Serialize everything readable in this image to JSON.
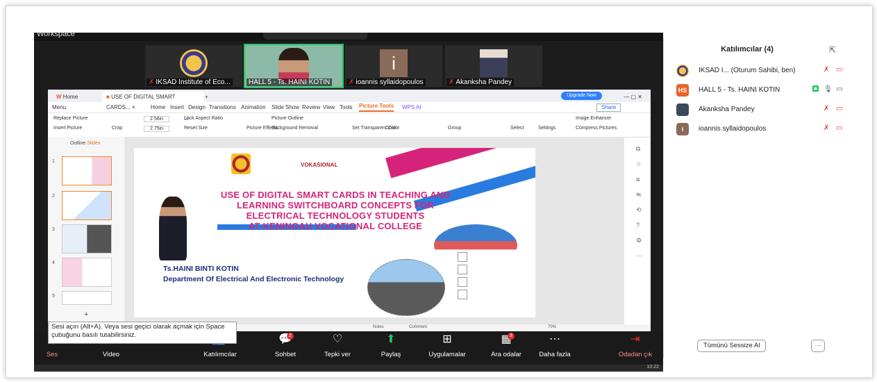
{
  "workspace_label": "Workspace",
  "thumbnails": [
    {
      "name": "IKSAD Institute of Eco...",
      "muted": true
    },
    {
      "name": "HALL 5 - Ts. HAINI KOTIN",
      "muted": false
    },
    {
      "name": "ioannis syllaidopoulos",
      "muted": true,
      "initial": "i"
    },
    {
      "name": "Akanksha Pandey",
      "muted": true
    }
  ],
  "wps": {
    "home_tab": "Home",
    "doc_tab": "USE OF DIGITAL SMART CARDS...",
    "upgrade": "Upgrade Now",
    "share": "Share",
    "menu": [
      "Menu",
      "Home",
      "Insert",
      "Design",
      "Transitions",
      "Animation",
      "Slide Show",
      "Review",
      "View",
      "Tools",
      "Picture Tools",
      "WPS AI"
    ],
    "ribbon": {
      "replace_picture": "Replace Picture",
      "insert_picture": "Insert Picture",
      "crop": "Crop",
      "width": "2.56in",
      "height": "2.75in",
      "lock_aspect": "Lock Aspect Ratio",
      "reset_size": "Reset Size",
      "picture_effects": "Picture Effects",
      "picture_outline": "Picture Outline",
      "background_removal": "Background Removal",
      "set_transparent": "Set Transparent Color",
      "color": "Color",
      "group": "Group",
      "select": "Select",
      "settings": "Settings",
      "image_enhancer": "Image Enhancer",
      "compress_pictures": "Compress Pictures"
    },
    "outline_tab": "Outline",
    "slides_tab": "Slides",
    "slide_numbers": [
      "1",
      "2",
      "3",
      "4",
      "5"
    ],
    "add_slide": "+",
    "slide": {
      "logo_text": "VOKASIONAL",
      "title_lines": [
        "USE OF DIGITAL SMART CARDS IN TEACHING AND",
        "LEARNING SWITCHBOARD CONCEPTS FOR",
        "ELECTRICAL TECHNOLOGY STUDENTS",
        "AT KENINGAU VOCATIONAL COLLEGE"
      ],
      "author": "Ts.HAINI BINTI KOTIN",
      "department": "Department Of Electrical And Electronic Technology"
    },
    "status": {
      "notes": "Notes",
      "comment": "Comment",
      "zoom": "70%"
    }
  },
  "tooltip": "Sesi açın (Alt+A). Veya sesi geçici olarak açmak için Space çubuğunu basılı tutabilirsiniz.",
  "toolbar": {
    "audio": "Ses",
    "video": "Video",
    "participants": "Katılımcılar",
    "participants_count": "4",
    "chat": "Sohbet",
    "chat_badge": "2",
    "react": "Tepki ver",
    "share": "Paylaş",
    "apps": "Uygulamalar",
    "apps_badge": "3",
    "breakout": "Ara odalar",
    "more": "Daha fazla",
    "leave": "Odadan çık"
  },
  "panel": {
    "title": "Katılımcılar (4)",
    "participants": [
      {
        "name": "IKSAD I... (Oturum Sahibi, ben)",
        "avatar": "",
        "color": "#ffffff"
      },
      {
        "name": "HALL 5 - Ts. HAINI KOTIN",
        "avatar": "HS",
        "color": "#e8622a"
      },
      {
        "name": "Akanksha Pandey",
        "avatar": "",
        "color": "#3a4a5c"
      },
      {
        "name": "ioannis syllaidopoulos",
        "avatar": "i",
        "color": "#8a6a58"
      }
    ],
    "mute_all": "Tümünü Sessize Al",
    "more": "···"
  },
  "clock": "10:22",
  "colors": {
    "accent_green": "#22c55e",
    "muted_red": "#e0322a",
    "slide_title": "#d6247a",
    "slide_author": "#1c2f7a",
    "wps_accent": "#f28b26"
  }
}
